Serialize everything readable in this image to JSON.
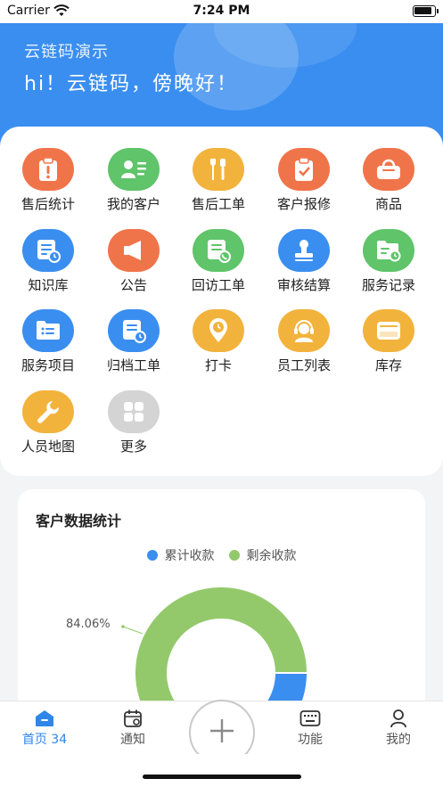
{
  "status_bar": {
    "carrier": "Carrier",
    "time": "7:24 PM"
  },
  "header": {
    "company": "云链码演示",
    "greeting": "hi！云链码，傍晚好！"
  },
  "menu": {
    "items": [
      {
        "label": "售后统计",
        "icon": "clipboard-alert-icon",
        "color": "#f0744a"
      },
      {
        "label": "我的客户",
        "icon": "contact-card-icon",
        "color": "#5fc46a"
      },
      {
        "label": "售后工单",
        "icon": "tools-icon",
        "color": "#f2b33c"
      },
      {
        "label": "客户报修",
        "icon": "clipboard-check-icon",
        "color": "#f0744a"
      },
      {
        "label": "商品",
        "icon": "shopping-bag-icon",
        "color": "#f0744a"
      },
      {
        "label": "知识库",
        "icon": "document-clock-icon",
        "color": "#3a8ef0"
      },
      {
        "label": "公告",
        "icon": "megaphone-icon",
        "color": "#f0744a"
      },
      {
        "label": "回访工单",
        "icon": "document-phone-icon",
        "color": "#5fc46a"
      },
      {
        "label": "审核结算",
        "icon": "stamp-icon",
        "color": "#3a8ef0"
      },
      {
        "label": "服务记录",
        "icon": "folder-clock-icon",
        "color": "#5fc46a"
      },
      {
        "label": "服务项目",
        "icon": "folder-list-icon",
        "color": "#3a8ef0"
      },
      {
        "label": "归档工单",
        "icon": "archive-clock-icon",
        "color": "#3a8ef0"
      },
      {
        "label": "打卡",
        "icon": "location-clock-icon",
        "color": "#f2b33c"
      },
      {
        "label": "员工列表",
        "icon": "headset-person-icon",
        "color": "#f2b33c"
      },
      {
        "label": "库存",
        "icon": "inventory-box-icon",
        "color": "#f2b33c"
      },
      {
        "label": "人员地图",
        "icon": "wrench-icon",
        "color": "#f2b33c"
      },
      {
        "label": "更多",
        "icon": "grid-more-icon",
        "color": "#d4d4d4"
      }
    ]
  },
  "stats": {
    "title": "客户数据统计",
    "legend": [
      {
        "label": "累计收款",
        "color": "#3a8ef0"
      },
      {
        "label": "剩余收款",
        "color": "#93c96b"
      }
    ],
    "percent_label": "84.06%"
  },
  "chart_data": {
    "type": "pie",
    "title": "客户数据统计",
    "categories": [
      "累计收款",
      "剩余收款"
    ],
    "values": [
      15.94,
      84.06
    ],
    "colors": [
      "#3a8ef0",
      "#93c96b"
    ],
    "style": "donut",
    "legend_position": "top-center"
  },
  "tabbar": {
    "tabs": [
      {
        "label": "首页 34",
        "icon": "home-icon",
        "active": true
      },
      {
        "label": "通知",
        "icon": "calendar-bell-icon",
        "active": false
      },
      {
        "label": "功能",
        "icon": "keyboard-icon",
        "active": false
      },
      {
        "label": "我的",
        "icon": "person-icon",
        "active": false
      }
    ],
    "center_button_icon": "plus-icon"
  }
}
